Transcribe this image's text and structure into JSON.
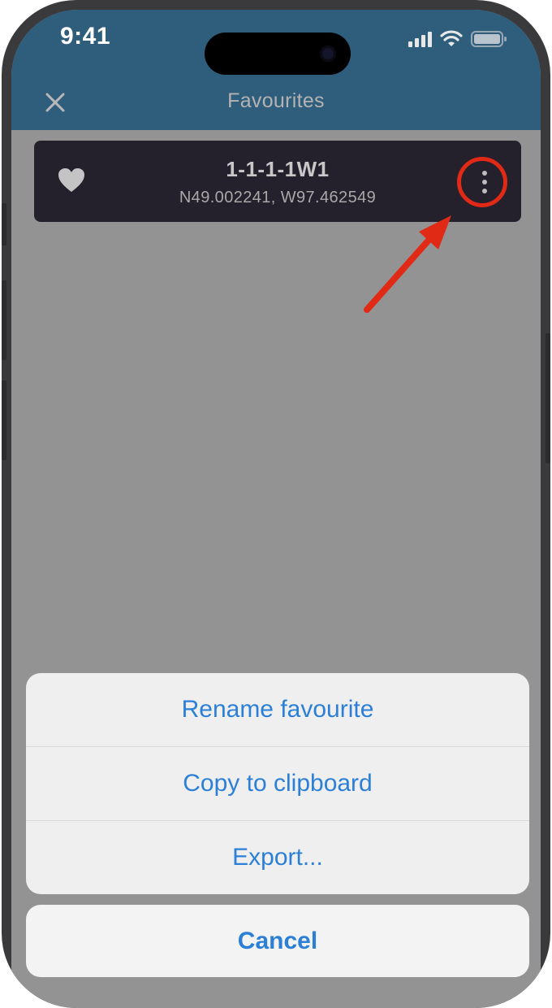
{
  "status_bar": {
    "time": "9:41"
  },
  "header": {
    "title": "Favourites",
    "close_icon": "close-icon"
  },
  "favourite": {
    "name": "1-1-1-1W1",
    "coordinates": "N49.002241, W97.462549",
    "icon": "heart-icon"
  },
  "annotation": {
    "ring_color": "#e02a16",
    "arrow_color": "#e02a16"
  },
  "action_sheet": {
    "items": [
      {
        "label": "Rename favourite"
      },
      {
        "label": "Copy to clipboard"
      },
      {
        "label": "Export..."
      }
    ],
    "cancel_label": "Cancel",
    "accent_color": "#2b7fd6"
  },
  "colors": {
    "header": "#2f5e7d",
    "card": "#24202c",
    "overlay": "#939393"
  }
}
